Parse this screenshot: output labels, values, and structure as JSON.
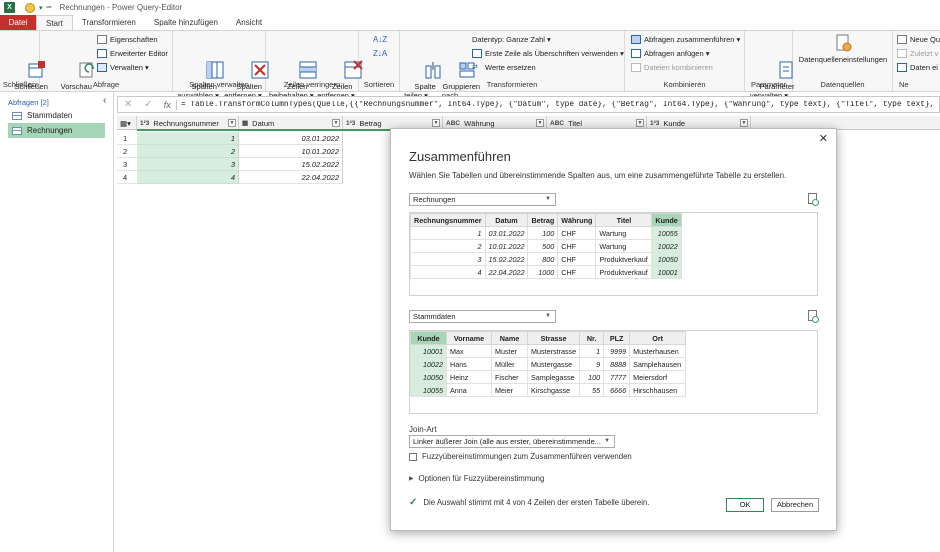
{
  "window": {
    "title": "Rechnungen - Power Query-Editor"
  },
  "tabs": [
    "Datei",
    "Start",
    "Transformieren",
    "Spalte hinzufügen",
    "Ansicht"
  ],
  "ribbon": {
    "schliessen": {
      "close_load": "Schließen\n& laden",
      "group": "Schließen"
    },
    "abfrage": {
      "refresh": "Vorschau\naktualisieren",
      "properties": "Eigenschaften",
      "advanced_editor": "Erweiterter Editor",
      "manage": "Verwalten",
      "group": "Abfrage"
    },
    "spalten_verwalten": {
      "choose": "Spalten\nauswählen",
      "remove": "Spalten\nentfernen",
      "group": "Spalten verwalten"
    },
    "zeilen_verringern": {
      "keep": "Zeilen\nbeibehalten",
      "remove": "Zeilen\nentfernen",
      "group": "Zeilen verringern"
    },
    "sortieren": {
      "group": "Sortieren"
    },
    "transformieren": {
      "split": "Spalte\nteilen",
      "group_by": "Gruppieren\nnach",
      "datatype": "Datentyp: Ganze Zahl",
      "first_row_headers": "Erste Zeile als Überschriften verwenden",
      "replace_values": "Werte ersetzen",
      "group": "Transformieren"
    },
    "kombinieren": {
      "merge": "Abfragen zusammenführen",
      "append": "Abfragen anfügen",
      "combine_files": "Dateien kombinieren",
      "group": "Kombinieren"
    },
    "parameter": {
      "manage": "Parameter\nverwalten",
      "group": "Parameter"
    },
    "datenquellen": {
      "settings": "Datenquelleneinstellungen",
      "group": "Datenquellen"
    },
    "neue_abfrage": {
      "new_source": "Neue Qu",
      "recent": "Zuletzt v",
      "enter_data": "Daten ei",
      "group": "Ne"
    }
  },
  "queries": {
    "header": "Abfragen [2]",
    "items": [
      "Stammdaten",
      "Rechnungen"
    ],
    "selected": "Rechnungen"
  },
  "formula": {
    "text": "= Table.TransformColumnTypes(Quelle,{{\"Rechnungsnummer\", Int64.Type}, {\"Datum\", type date}, {\"Betrag\", Int64.Type}, {\"Währung\", type text}, {\"Titel\", type text}, {\"Kunde\", Int6"
  },
  "grid": {
    "columns": [
      {
        "type": "1²3",
        "name": "Rechnungsnummer"
      },
      {
        "type": "▦",
        "name": "Datum"
      },
      {
        "type": "1²3",
        "name": "Betrag"
      },
      {
        "type": "ABC",
        "name": "Währung"
      },
      {
        "type": "ABC",
        "name": "Titel"
      },
      {
        "type": "1²3",
        "name": "Kunde"
      }
    ],
    "rows": [
      {
        "n": "1",
        "nr": "1",
        "datum": "03.01.2022"
      },
      {
        "n": "2",
        "nr": "2",
        "datum": "10.01.2022"
      },
      {
        "n": "3",
        "nr": "3",
        "datum": "15.02.2022"
      },
      {
        "n": "4",
        "nr": "4",
        "datum": "22.04.2022"
      }
    ]
  },
  "dialog": {
    "title": "Zusammenführen",
    "description": "Wählen Sie Tabellen und übereinstimmende Spalten aus, um eine zusammengeführte Tabelle zu erstellen.",
    "table1": {
      "select": "Rechnungen",
      "headers": [
        "Rechnungsnummer",
        "Datum",
        "Betrag",
        "Währung",
        "Titel",
        "Kunde"
      ],
      "rows": [
        [
          "1",
          "03.01.2022",
          "100",
          "CHF",
          "Wartung",
          "10055"
        ],
        [
          "2",
          "10.01.2022",
          "500",
          "CHF",
          "Wartung",
          "10022"
        ],
        [
          "3",
          "15.02.2022",
          "800",
          "CHF",
          "Produktverkauf",
          "10050"
        ],
        [
          "4",
          "22.04.2022",
          "1000",
          "CHF",
          "Produktverkauf",
          "10001"
        ]
      ]
    },
    "table2": {
      "select": "Stammdaten",
      "headers": [
        "Kunde",
        "Vorname",
        "Name",
        "Strasse",
        "Nr.",
        "PLZ",
        "Ort"
      ],
      "rows": [
        [
          "10001",
          "Max",
          "Muster",
          "Musterstrasse",
          "1",
          "9999",
          "Musterhausen"
        ],
        [
          "10022",
          "Hans",
          "Müller",
          "Mustergasse",
          "9",
          "8888",
          "Samplehausen"
        ],
        [
          "10050",
          "Heinz",
          "Fischer",
          "Samplegasse",
          "100",
          "7777",
          "Meiersdorf"
        ],
        [
          "10055",
          "Anna",
          "Meier",
          "Kirschgasse",
          "55",
          "6666",
          "Hirschhausen"
        ]
      ]
    },
    "join_label": "Join-Art",
    "join_value": "Linker äußerer Join (alle aus erster, übereinstimmende...",
    "fuzzy_label": "Fuzzyübereinstimmungen zum Zusammenführen verwenden",
    "fuzzy_options": "Optionen für Fuzzyübereinstimmung",
    "status": "Die Auswahl stimmt mit 4 von 4 Zeilen der ersten Tabelle überein.",
    "ok": "OK",
    "cancel": "Abbrechen"
  },
  "colors": {
    "accent_green": "#217346",
    "file_tab": "#c4302b",
    "selection": "#a7d5b8",
    "highlight": "#d7eedf"
  }
}
